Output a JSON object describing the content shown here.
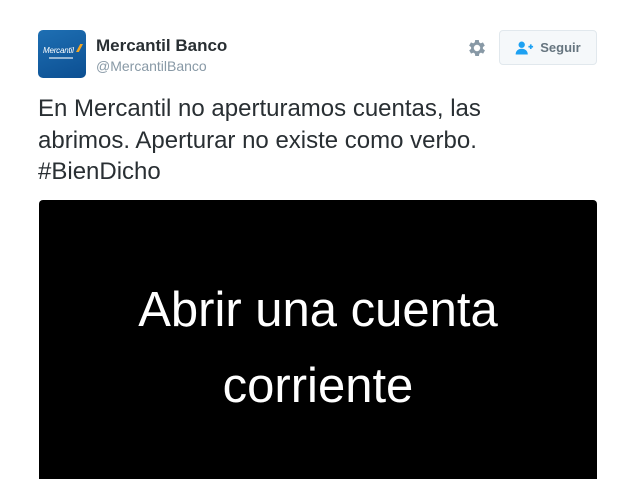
{
  "account": {
    "name": "Mercantil Banco",
    "handle": "@MercantilBanco",
    "avatar_icon": "mercantil-logo",
    "avatar_logo_text": "Mercantil",
    "brand_color": "#1b66aa",
    "accent_color": "#f2a623"
  },
  "actions": {
    "settings_icon": "gear-icon",
    "follow_icon": "add-user-icon",
    "follow_label": "Seguir"
  },
  "tweet": {
    "text_lines": [
      "En Mercantil no aperturamos cuentas, las",
      "abrimos. Aperturar no existe como verbo.",
      "#BienDicho"
    ]
  },
  "media": {
    "background": "#000000",
    "text_lines": [
      "Abrir una cuenta",
      "corriente"
    ]
  }
}
